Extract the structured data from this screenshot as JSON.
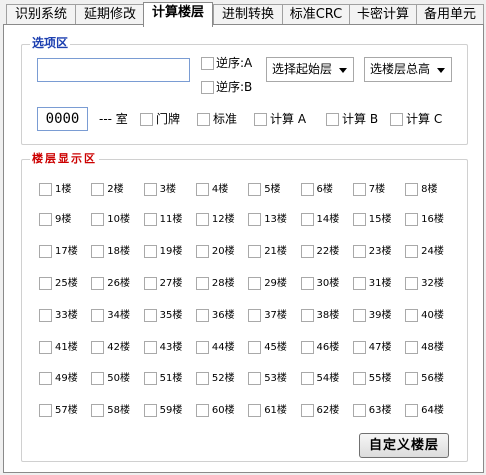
{
  "tabs": [
    {
      "label": "识别系统",
      "active": false
    },
    {
      "label": "延期修改",
      "active": false
    },
    {
      "label": "计算楼层",
      "active": true
    },
    {
      "label": "进制转换",
      "active": false
    },
    {
      "label": "标准CRC",
      "active": false
    },
    {
      "label": "卡密计算",
      "active": false
    },
    {
      "label": "备用单元",
      "active": false
    }
  ],
  "options": {
    "title": "选项区",
    "input_value": "",
    "reverse_a": "逆序:A",
    "reverse_b": "逆序:B",
    "start_floor_select": "选择起始层",
    "total_floor_select": "选楼层总高",
    "code_value": "0000",
    "room_label": "--- 室",
    "door_label": "门牌",
    "standard_label": "标准",
    "calc_a": "计算 A",
    "calc_b": "计算 B",
    "calc_c": "计算 C"
  },
  "floors": {
    "title": "楼层显示区",
    "items": [
      "1楼",
      "2楼",
      "3楼",
      "4楼",
      "5楼",
      "6楼",
      "7楼",
      "8楼",
      "9楼",
      "10楼",
      "11楼",
      "12楼",
      "13楼",
      "14楼",
      "15楼",
      "16楼",
      "17楼",
      "18楼",
      "19楼",
      "20楼",
      "21楼",
      "22楼",
      "23楼",
      "24楼",
      "25楼",
      "26楼",
      "27楼",
      "28楼",
      "29楼",
      "30楼",
      "31楼",
      "32楼",
      "33楼",
      "34楼",
      "35楼",
      "36楼",
      "37楼",
      "38楼",
      "39楼",
      "40楼",
      "41楼",
      "42楼",
      "43楼",
      "44楼",
      "45楼",
      "46楼",
      "47楼",
      "48楼",
      "49楼",
      "50楼",
      "51楼",
      "52楼",
      "53楼",
      "54楼",
      "55楼",
      "56楼",
      "57楼",
      "58楼",
      "59楼",
      "60楼",
      "61楼",
      "62楼",
      "63楼",
      "64楼"
    ],
    "custom_button": "自定义楼层"
  }
}
